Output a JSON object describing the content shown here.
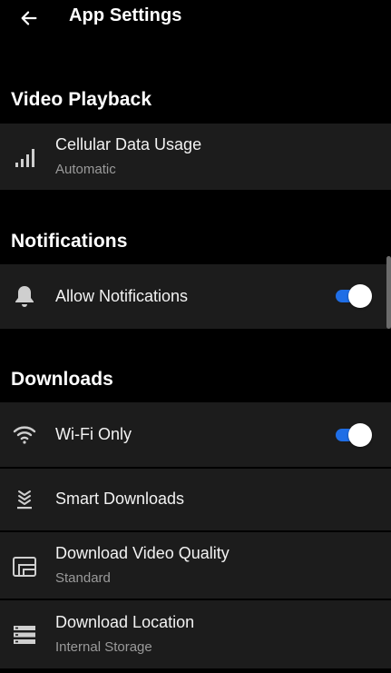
{
  "header": {
    "title": "App Settings",
    "back_icon": "arrow-left-icon"
  },
  "sections": {
    "video_playback": {
      "title": "Video Playback",
      "items": [
        {
          "label": "Cellular Data Usage",
          "value": "Automatic",
          "icon": "signal-bars-icon"
        }
      ]
    },
    "notifications": {
      "title": "Notifications",
      "items": [
        {
          "label": "Allow Notifications",
          "icon": "bell-icon",
          "toggle_on": true
        }
      ]
    },
    "downloads": {
      "title": "Downloads",
      "items": [
        {
          "label": "Wi-Fi Only",
          "icon": "wifi-icon",
          "toggle_on": true
        },
        {
          "label": "Smart Downloads",
          "icon": "smart-download-icon"
        },
        {
          "label": "Download Video Quality",
          "value": "Standard",
          "icon": "video-quality-icon"
        },
        {
          "label": "Download Location",
          "value": "Internal Storage",
          "icon": "storage-icon"
        }
      ]
    }
  },
  "colors": {
    "background": "#000000",
    "row": "#1c1c1c",
    "toggle_on": "#1f6ee6",
    "subtext": "#9a9a9a"
  }
}
